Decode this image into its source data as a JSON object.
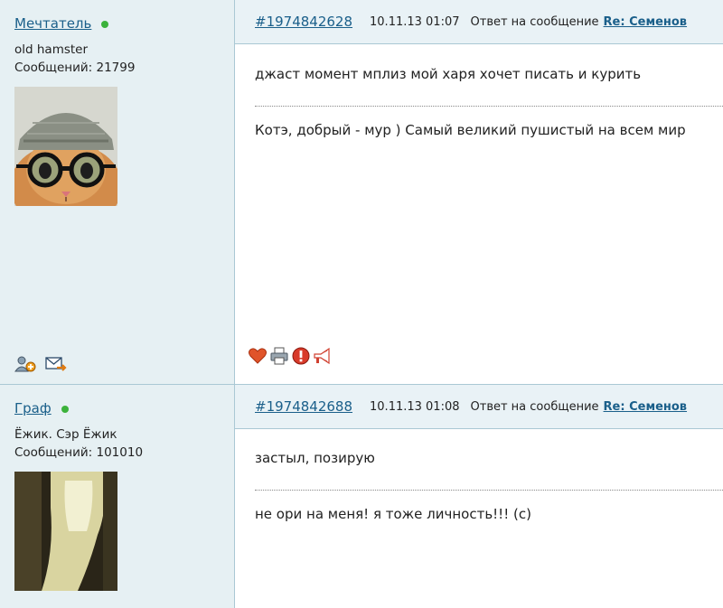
{
  "posts": [
    {
      "username": "Мечтатель",
      "user_title": "old hamster",
      "post_count_label": "Сообщений: 21799",
      "post_id": "#1974842628",
      "date": "10.11.13 01:07",
      "reply_label": "Ответ на сообщение",
      "thread_title": "Re: Семенов",
      "message": "джаст момент мплиз мой харя хочет писать и курить",
      "signature": "Котэ, добрый - мур ) Самый великий пушистый на всем мир"
    },
    {
      "username": "Граф",
      "user_title": "Ёжик. Сэр Ёжик",
      "post_count_label": "Сообщений: 101010",
      "post_id": "#1974842688",
      "date": "10.11.13 01:08",
      "reply_label": "Ответ на сообщение",
      "thread_title": "Re: Семенов",
      "message": "застыл, позирую",
      "signature": "не ори на меня! я тоже личность!!! (с)"
    }
  ],
  "colors": {
    "link": "#1a5f8a",
    "online": "#3bb23b",
    "sidebar_bg": "#e6f0f3",
    "header_bg": "#e9f2f6",
    "border": "#aac8d4"
  },
  "icons": {
    "user_actions": [
      "add-friend-icon",
      "send-message-icon"
    ],
    "post_actions": [
      "heart-icon",
      "print-icon",
      "report-icon",
      "megaphone-icon"
    ]
  }
}
